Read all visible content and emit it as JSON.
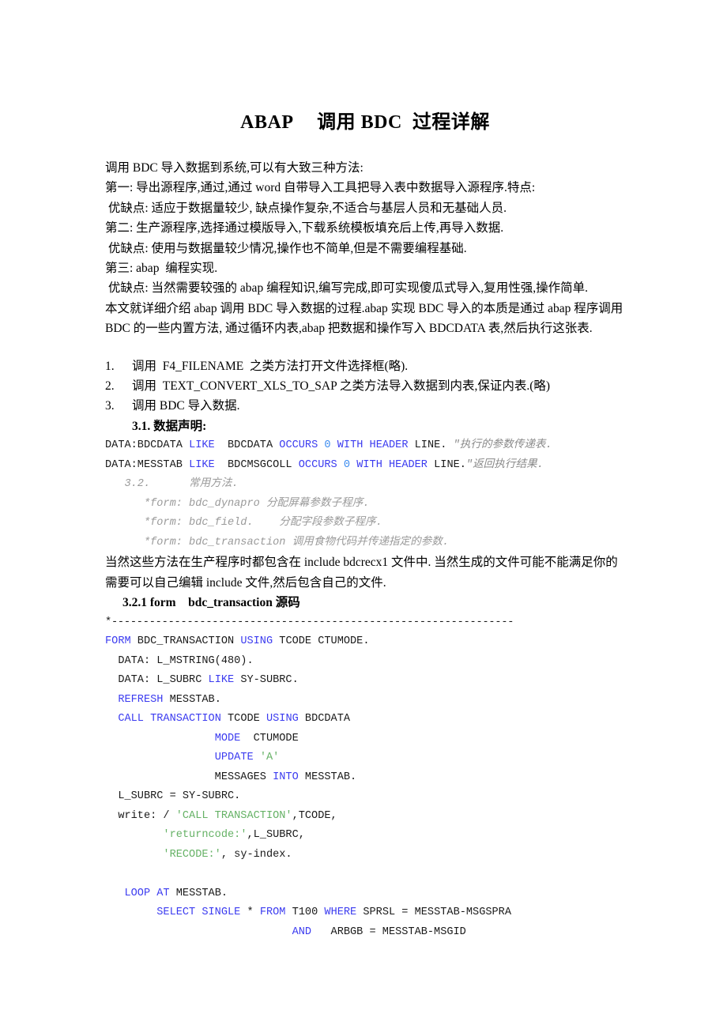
{
  "document": {
    "title": "ABAP　 调用 BDC  过程详解",
    "intro": [
      "调用 BDC 导入数据到系统,可以有大致三种方法:",
      "第一: 导出源程序,通过,通过 word 自带导入工具把导入表中数据导入源程序.特点:",
      " 优缺点: 适应于数据量较少, 缺点操作复杂,不适合与基层人员和无基础人员.",
      "第二: 生产源程序,选择通过模版导入,下载系统模板填充后上传,再导入数据.",
      " 优缺点: 使用与数据量较少情况,操作也不简单,但是不需要编程基础.",
      "第三: abap  编程实现.",
      " 优缺点: 当然需要较强的 abap 编程知识,编写完成,即可实现傻瓜式导入,复用性强,操作简单.",
      "本文就详细介绍 abap 调用 BDC 导入数据的过程.abap 实现 BDC 导入的本质是通过 abap 程序调用 BDC 的一些内置方法, 通过循环内表,abap 把数据和操作写入 BDCDATA 表,然后执行这张表."
    ],
    "steps": [
      {
        "marker": "1.",
        "text": "调用  F4_FILENAME  之类方法打开文件选择框(略)."
      },
      {
        "marker": "2.",
        "text": "调用  TEXT_CONVERT_XLS_TO_SAP 之类方法导入数据到内表,保证内表.(略)"
      },
      {
        "marker": "3.",
        "text": "调用 BDC 导入数据."
      }
    ],
    "section_3_1_heading": "3.1. 数据声明:",
    "data_declaration": [
      {
        "parts": [
          {
            "t": "DATA:BDCDATA ",
            "c": "plain"
          },
          {
            "t": "LIKE",
            "c": "kw"
          },
          {
            "t": "  BDCDATA ",
            "c": "plain"
          },
          {
            "t": "OCCURS",
            "c": "kw"
          },
          {
            "t": " ",
            "c": "plain"
          },
          {
            "t": "0",
            "c": "num"
          },
          {
            "t": " ",
            "c": "plain"
          },
          {
            "t": "WITH HEADER",
            "c": "kw"
          },
          {
            "t": " LINE. ",
            "c": "plain"
          },
          {
            "t": "\"执行的参数传递表.",
            "c": "cmt"
          }
        ]
      },
      {
        "parts": [
          {
            "t": "DATA:MESSTAB ",
            "c": "plain"
          },
          {
            "t": "LIKE",
            "c": "kw"
          },
          {
            "t": "  BDCMSGCOLL ",
            "c": "plain"
          },
          {
            "t": "OCCURS",
            "c": "kw"
          },
          {
            "t": " ",
            "c": "plain"
          },
          {
            "t": "0",
            "c": "num"
          },
          {
            "t": " ",
            "c": "plain"
          },
          {
            "t": "WITH HEADER",
            "c": "kw"
          },
          {
            "t": " LINE.",
            "c": "plain"
          },
          {
            "t": "\"返回执行结果.",
            "c": "cmt"
          }
        ]
      }
    ],
    "section_3_2_heading": "   3.2.      常用方法.",
    "method_comments": [
      "      *form: bdc_dynapro 分配屏幕参数子程序.",
      "      *form: bdc_field.    分配字段参数子程序.",
      "      *form: bdc_transaction 调用食物代码并传递指定的参数."
    ],
    "include_note": "当然这些方法在生产程序时都包含在 include bdcrecx1 文件中. 当然生成的文件可能不能满足你的需要可以自己编辑 include 文件,然后包含自己的文件.",
    "section_3_2_1_heading": "3.2.1 form    bdc_transaction 源码",
    "code_divider": "*----------------------------------------------------------------",
    "code_lines": [
      {
        "parts": [
          {
            "t": "FORM",
            "c": "kw"
          },
          {
            "t": " BDC_TRANSACTION ",
            "c": "plain"
          },
          {
            "t": "USING",
            "c": "kw"
          },
          {
            "t": " TCODE CTUMODE.",
            "c": "plain"
          }
        ]
      },
      {
        "parts": [
          {
            "t": "  DATA: L_MSTRING(480).",
            "c": "plain"
          }
        ]
      },
      {
        "parts": [
          {
            "t": "  DATA: L_SUBRC ",
            "c": "plain"
          },
          {
            "t": "LIKE",
            "c": "kw"
          },
          {
            "t": " SY-SUBRC.",
            "c": "plain"
          }
        ]
      },
      {
        "parts": [
          {
            "t": "  ",
            "c": "plain"
          },
          {
            "t": "REFRESH",
            "c": "kw"
          },
          {
            "t": " MESSTAB.",
            "c": "plain"
          }
        ]
      },
      {
        "parts": [
          {
            "t": "  ",
            "c": "plain"
          },
          {
            "t": "CALL TRANSACTION",
            "c": "kw"
          },
          {
            "t": " TCODE ",
            "c": "plain"
          },
          {
            "t": "USING",
            "c": "kw"
          },
          {
            "t": " BDCDATA",
            "c": "plain"
          }
        ]
      },
      {
        "parts": [
          {
            "t": "                 ",
            "c": "plain"
          },
          {
            "t": "MODE",
            "c": "kw"
          },
          {
            "t": "  CTUMODE",
            "c": "plain"
          }
        ]
      },
      {
        "parts": [
          {
            "t": "                 ",
            "c": "plain"
          },
          {
            "t": "UPDATE",
            "c": "kw"
          },
          {
            "t": " ",
            "c": "plain"
          },
          {
            "t": "'A'",
            "c": "str"
          }
        ]
      },
      {
        "parts": [
          {
            "t": "                 MESSAGES ",
            "c": "plain"
          },
          {
            "t": "INTO",
            "c": "kw"
          },
          {
            "t": " MESSTAB.",
            "c": "plain"
          }
        ]
      },
      {
        "parts": [
          {
            "t": "  L_SUBRC = SY-SUBRC.",
            "c": "plain"
          }
        ]
      },
      {
        "parts": [
          {
            "t": "  write: / ",
            "c": "plain"
          },
          {
            "t": "'CALL TRANSACTION'",
            "c": "str"
          },
          {
            "t": ",TCODE,",
            "c": "plain"
          }
        ]
      },
      {
        "parts": [
          {
            "t": "         ",
            "c": "plain"
          },
          {
            "t": "'returncode:'",
            "c": "str"
          },
          {
            "t": ",L_SUBRC,",
            "c": "plain"
          }
        ]
      },
      {
        "parts": [
          {
            "t": "         ",
            "c": "plain"
          },
          {
            "t": "'RECODE:'",
            "c": "str"
          },
          {
            "t": ", sy-index.",
            "c": "plain"
          }
        ]
      },
      {
        "parts": []
      },
      {
        "parts": [
          {
            "t": "   ",
            "c": "plain"
          },
          {
            "t": "LOOP AT",
            "c": "kw"
          },
          {
            "t": " MESSTAB.",
            "c": "plain"
          }
        ]
      },
      {
        "parts": [
          {
            "t": "        ",
            "c": "plain"
          },
          {
            "t": "SELECT SINGLE",
            "c": "kw"
          },
          {
            "t": " * ",
            "c": "plain"
          },
          {
            "t": "FROM",
            "c": "kw"
          },
          {
            "t": " T100 ",
            "c": "plain"
          },
          {
            "t": "WHERE",
            "c": "kw"
          },
          {
            "t": " SPRSL = MESSTAB-MSGSPRA",
            "c": "plain"
          }
        ]
      },
      {
        "parts": [
          {
            "t": "                             ",
            "c": "plain"
          },
          {
            "t": "AND",
            "c": "kw"
          },
          {
            "t": "   ARBGB = MESSTAB-MSGID",
            "c": "plain"
          }
        ]
      }
    ],
    "colors": {
      "keyword": "#3c3cf0",
      "number": "#3c8cf0",
      "string": "#66b266",
      "comment": "#8a8a8a",
      "text": "#000000",
      "background": "#ffffff"
    }
  }
}
